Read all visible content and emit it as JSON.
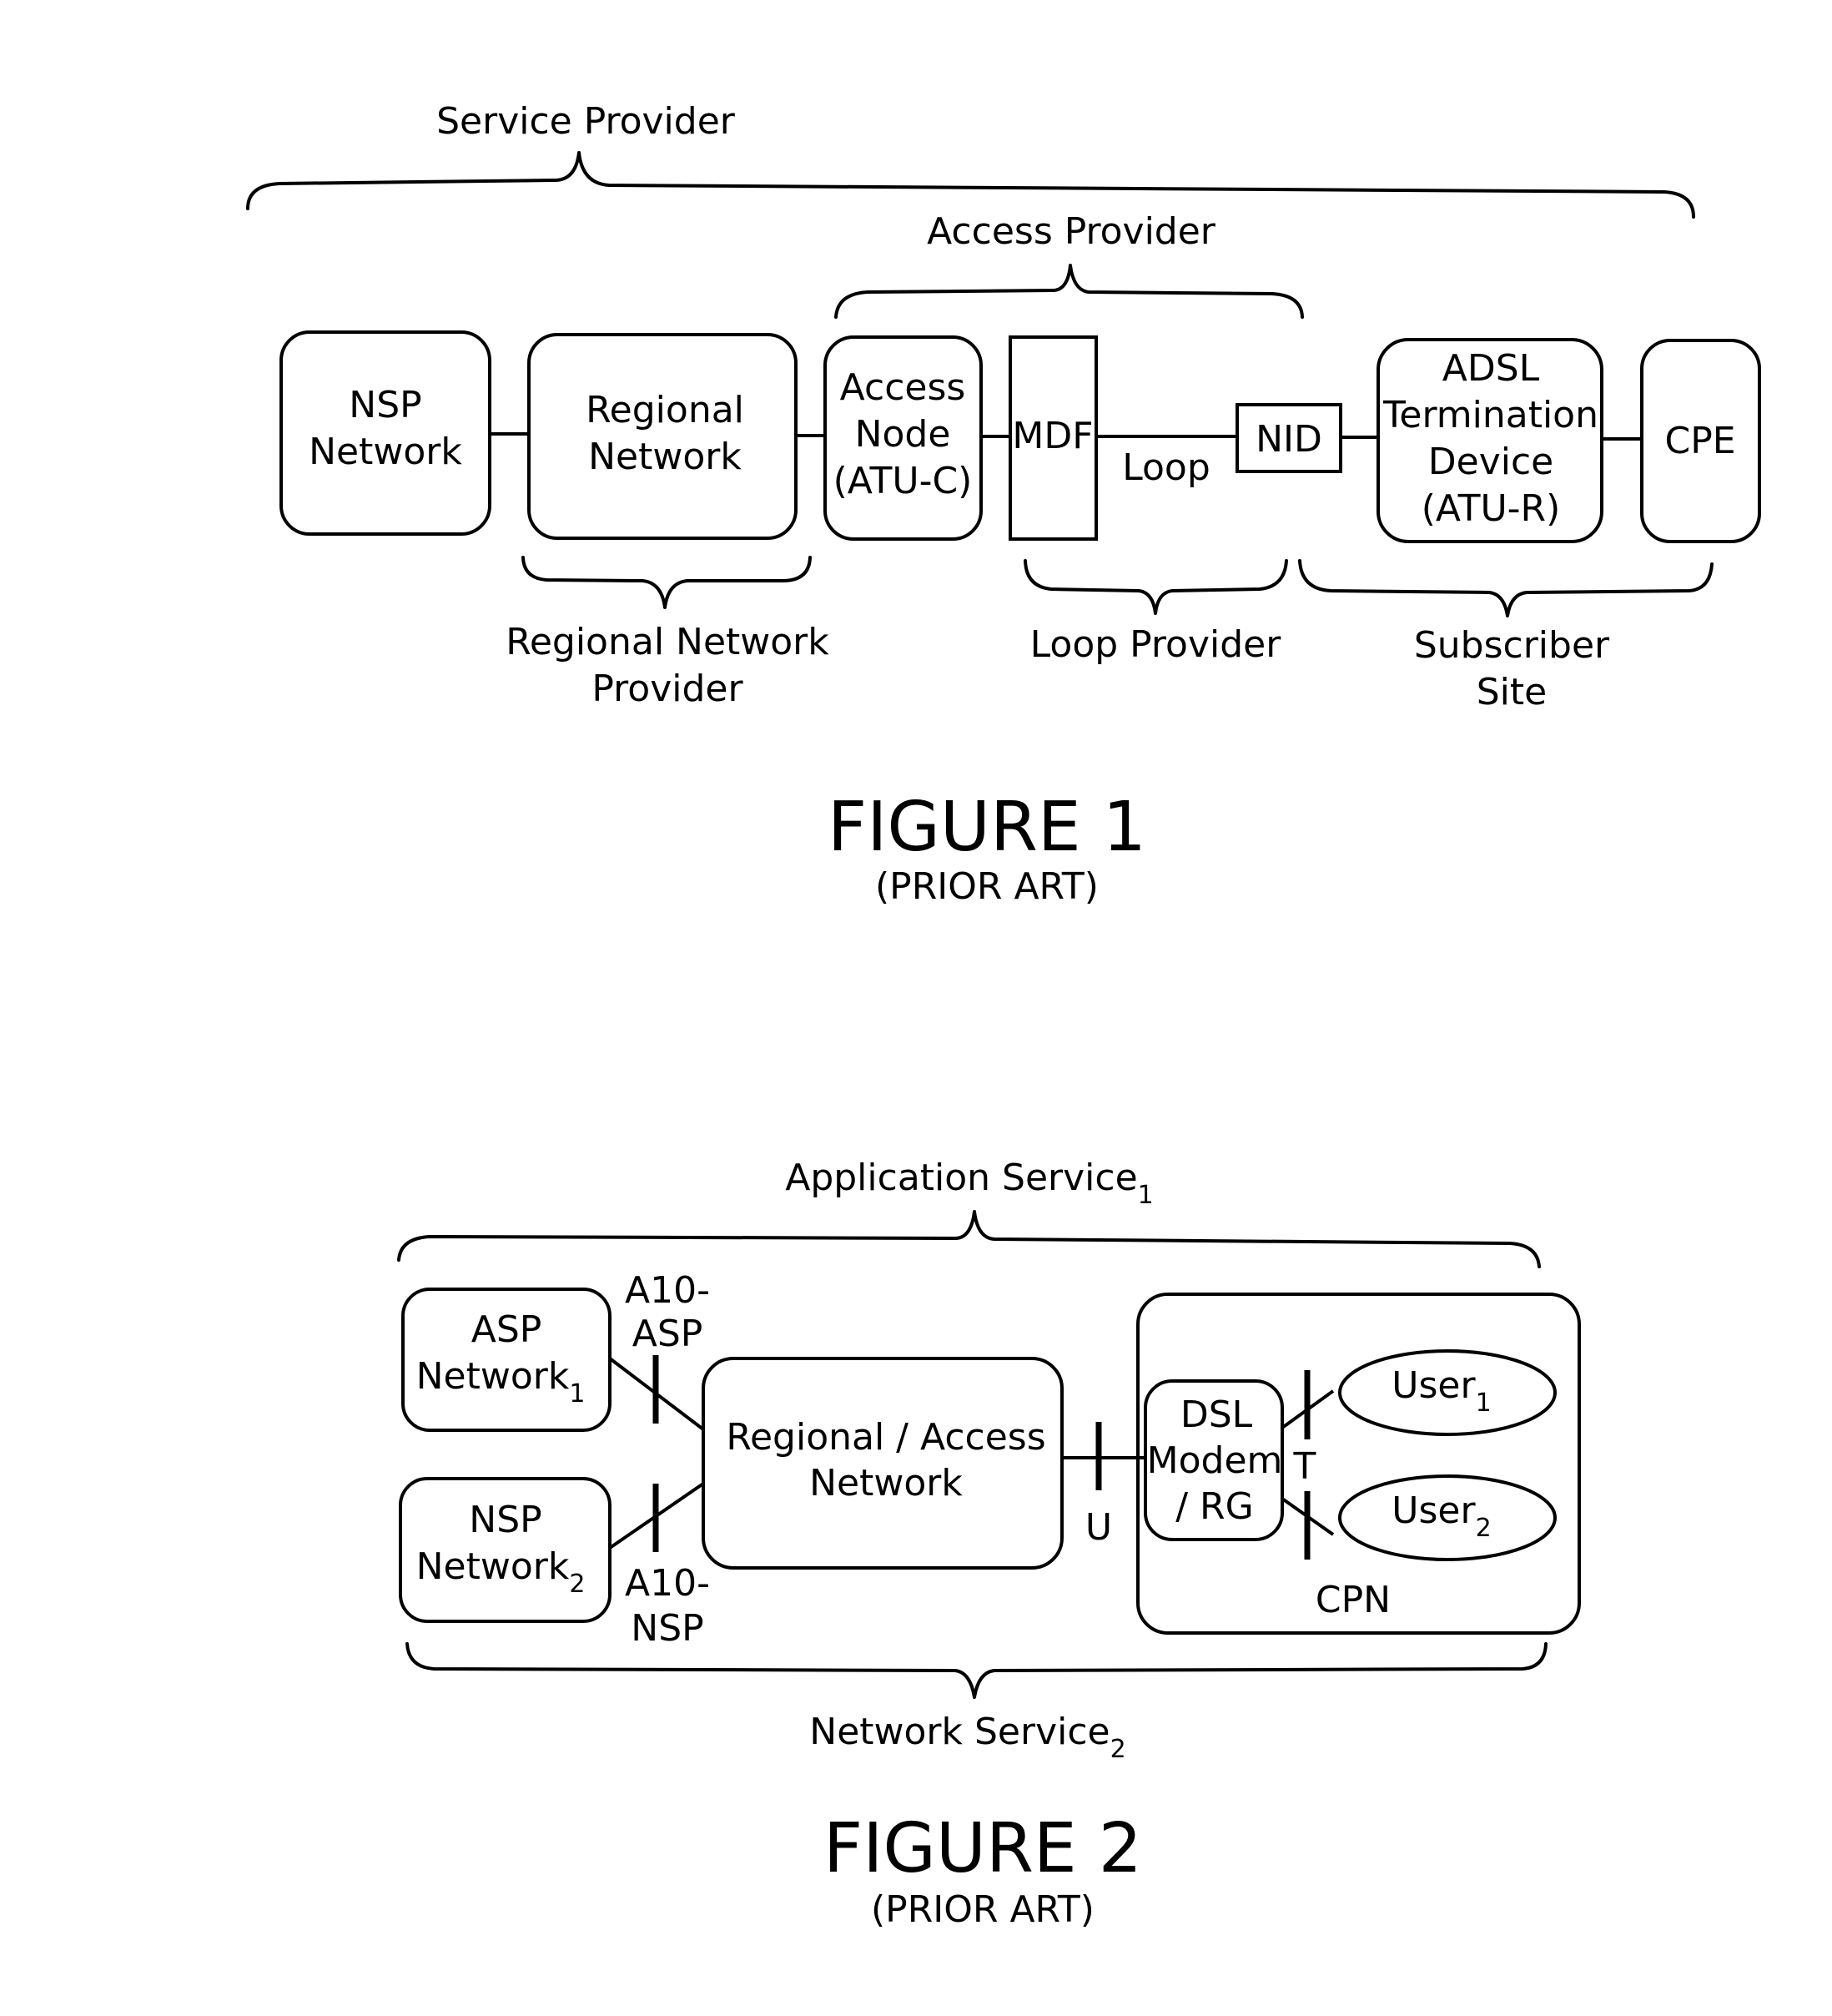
{
  "figure1": {
    "caption": "FIGURE 1",
    "subcaption": "(PRIOR ART)",
    "braces": {
      "service_provider": "Service Provider",
      "access_provider": "Access Provider",
      "regional_network_provider": [
        "Regional Network",
        "Provider"
      ],
      "loop_provider": "Loop Provider",
      "subscriber_site": [
        "Subscriber",
        "Site"
      ]
    },
    "nodes": {
      "nsp_network": [
        "NSP",
        "Network"
      ],
      "regional_network": [
        "Regional",
        "Network"
      ],
      "access_node": [
        "Access",
        "Node",
        "(ATU-C)"
      ],
      "mdf": "MDF",
      "nid": "NID",
      "adsl_termination": [
        "ADSL",
        "Termination",
        "Device",
        "(ATU-R)"
      ],
      "cpe": "CPE"
    },
    "loop_label": "Loop"
  },
  "figure2": {
    "caption": "FIGURE 2",
    "subcaption": "(PRIOR ART)",
    "braces": {
      "application_service": {
        "text": "Application Service",
        "subscript": "1"
      },
      "network_service": {
        "text": "Network Service",
        "subscript": "2"
      }
    },
    "nodes": {
      "asp_network": {
        "line1": "ASP",
        "line2": "Network",
        "subscript": "1"
      },
      "nsp_network": {
        "line1": "NSP",
        "line2": "Network",
        "subscript": "2"
      },
      "regional_access_network": [
        "Regional / Access",
        "Network"
      ],
      "dsl_modem": [
        "DSL",
        "Modem",
        "/ RG"
      ],
      "user1": {
        "text": "User",
        "subscript": "1"
      },
      "user2": {
        "text": "User",
        "subscript": "2"
      },
      "cpn": "CPN"
    },
    "interfaces": {
      "a10_asp": [
        "A10-",
        "ASP"
      ],
      "a10_nsp": [
        "A10-",
        "NSP"
      ],
      "u": "U",
      "t": "T"
    }
  }
}
